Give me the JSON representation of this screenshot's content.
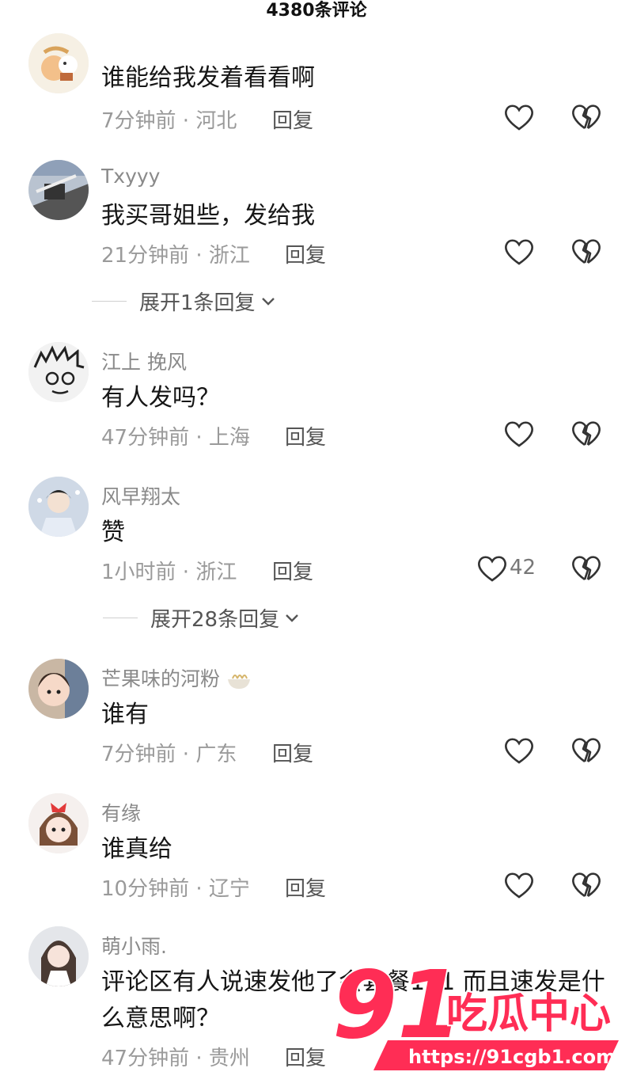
{
  "header": {
    "title": "4380条评论"
  },
  "comments": [
    {
      "user": "",
      "text": "谁能给我发着看看啊",
      "time": "7分钟前",
      "location": "河北",
      "reply": "回复",
      "likes": ""
    },
    {
      "user": "Txyyy",
      "text": "我买哥姐些，发给我",
      "time": "21分钟前",
      "location": "浙江",
      "reply": "回复",
      "likes": "",
      "expand": "展开1条回复"
    },
    {
      "user": "江上 挽风",
      "text": "有人发吗？",
      "time": "47分钟前",
      "location": "上海",
      "reply": "回复",
      "likes": ""
    },
    {
      "user": "风早翔太",
      "text": "赞",
      "time": "1小时前",
      "location": "浙江",
      "reply": "回复",
      "likes": "42",
      "expand": "展开28条回复"
    },
    {
      "user": "芒果味的河粉",
      "text": "谁有",
      "time": "7分钟前",
      "location": "广东",
      "reply": "回复",
      "likes": ""
    },
    {
      "user": "有缘",
      "text": "谁真给",
      "time": "10分钟前",
      "location": "辽宁",
      "reply": "回复",
      "likes": ""
    },
    {
      "user": "萌小雨.",
      "text": "评论区有人说速发他了会套餐111 而且速发是什么意思啊？",
      "time": "47分钟前",
      "location": "贵州",
      "reply": "回复",
      "likes": ""
    }
  ],
  "watermark": {
    "logo": "91",
    "brand": "吃瓜中心",
    "url": "https://91cgb1.com"
  },
  "colors": {
    "accent": "#ff2d55",
    "meta": "#9a9a9a"
  }
}
